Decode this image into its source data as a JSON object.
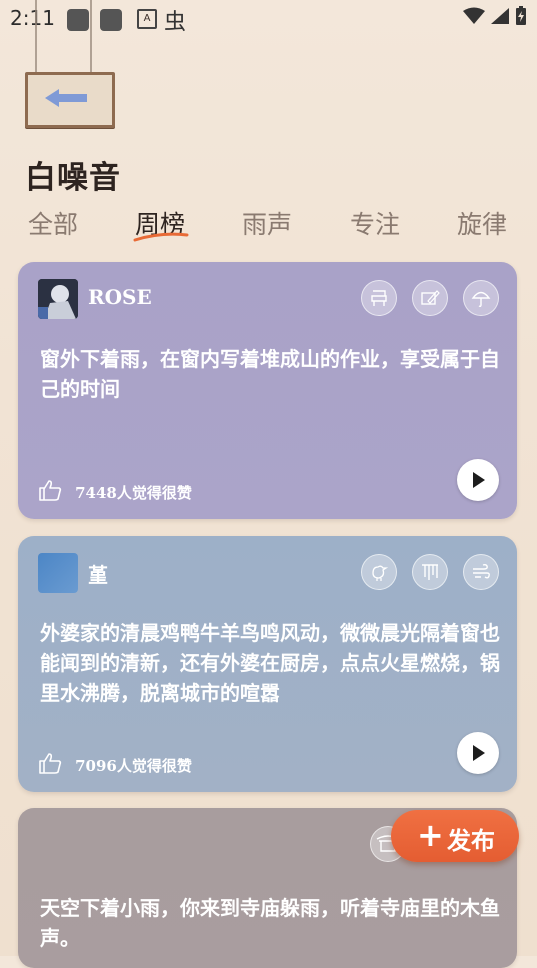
{
  "status_bar": {
    "time": "2:11",
    "a_badge": "A",
    "bug_glyph": "虫"
  },
  "header": {
    "title": "白噪音"
  },
  "tabs": [
    {
      "label": "全部",
      "active": false
    },
    {
      "label": "周榜",
      "active": true
    },
    {
      "label": "雨声",
      "active": false
    },
    {
      "label": "专注",
      "active": false
    },
    {
      "label": "旋律",
      "active": false
    }
  ],
  "cards": [
    {
      "username": "ROSE",
      "text": "窗外下着雨，在窗内写着堆成山的作业，享受属于自己的时间",
      "likes": "7448人觉得很赞",
      "color": "#a9a2c8"
    },
    {
      "username": "堇",
      "text": "外婆家的清晨鸡鸭牛羊鸟鸣风动，微微晨光隔着窗也能闻到的清新，还有外婆在厨房，点点火星燃烧，锅里水沸腾，脱离城市的喧嚣",
      "likes": "7096人觉得很赞",
      "color": "#9db0c8"
    },
    {
      "username": "",
      "text": "天空下着小雨，你来到寺庙躲雨，听着寺庙里的木鱼声。",
      "likes": "",
      "color": "#a89d9e"
    }
  ],
  "fab": {
    "plus": "+",
    "label": "发布",
    "color": "#e9643a"
  },
  "accent_color": "#e86a36"
}
